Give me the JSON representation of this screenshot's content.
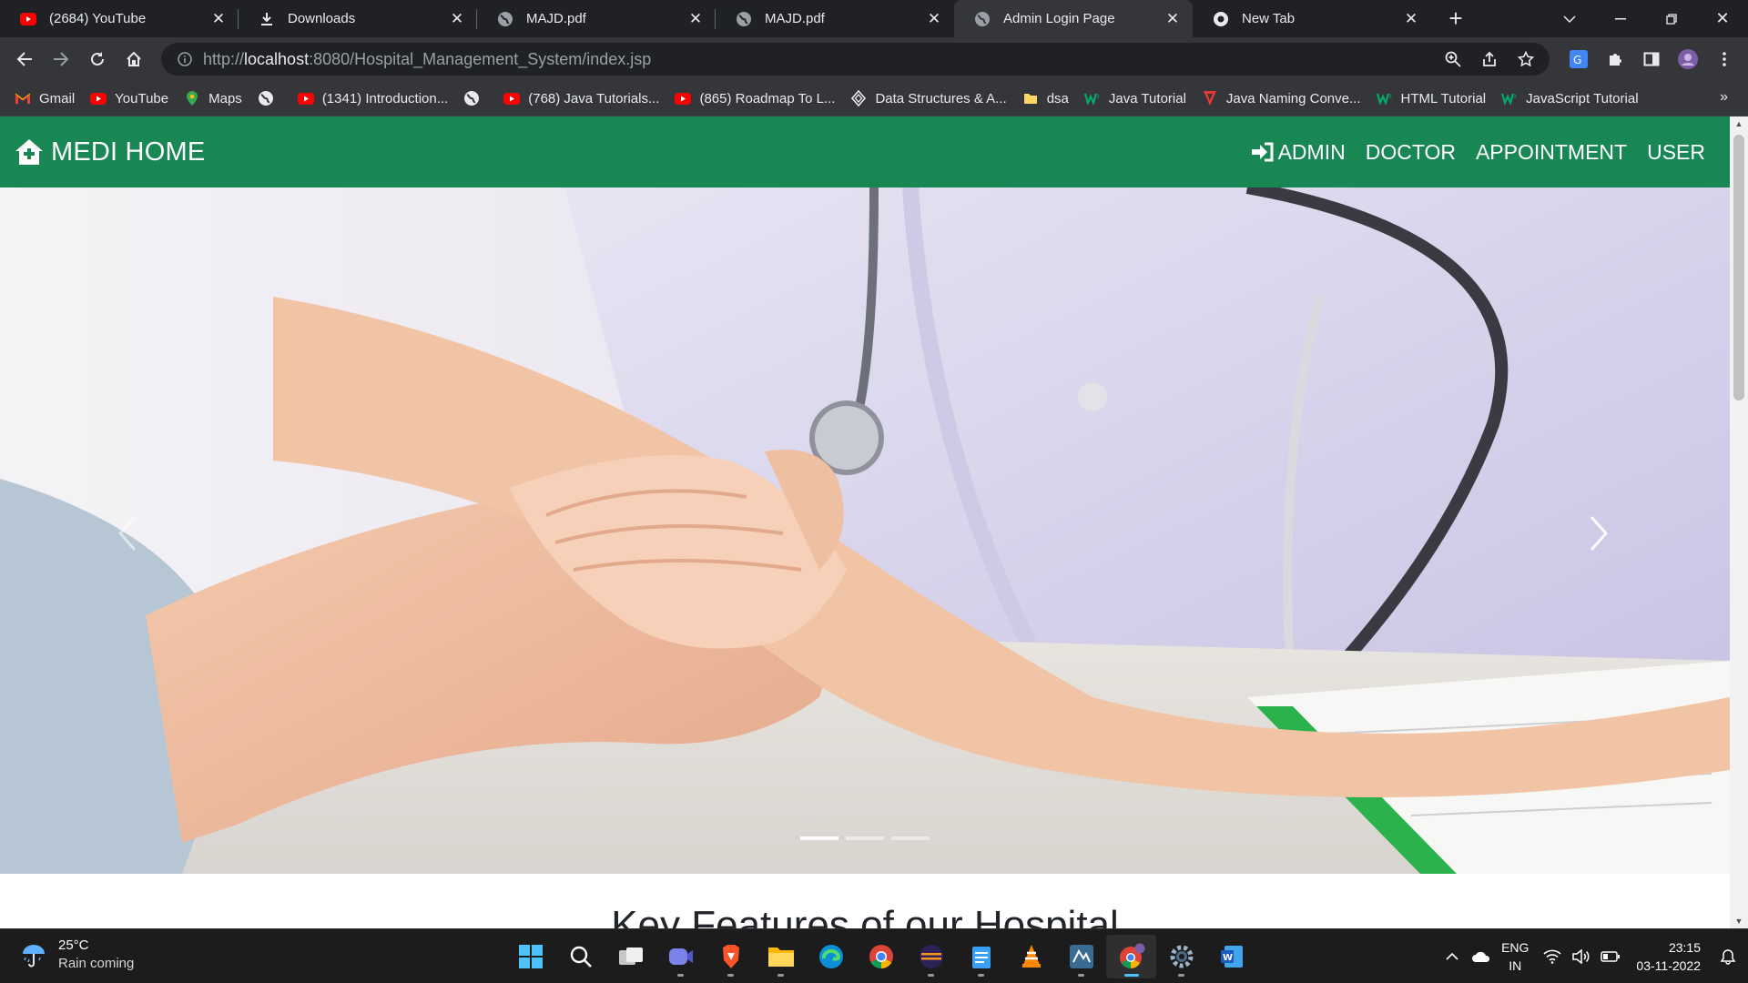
{
  "browser": {
    "tabs": [
      {
        "title": "(2684) YouTube",
        "icon": "youtube-icon",
        "active": false
      },
      {
        "title": "Downloads",
        "icon": "download-icon",
        "active": false
      },
      {
        "title": "MAJD.pdf",
        "icon": "globe-icon",
        "active": false
      },
      {
        "title": "MAJD.pdf",
        "icon": "globe-icon",
        "active": false
      },
      {
        "title": "Admin Login Page",
        "icon": "globe-icon",
        "active": true
      },
      {
        "title": "New Tab",
        "icon": "chrome-icon",
        "active": false
      }
    ],
    "url_prefix": "http://",
    "url_host": "localhost",
    "url_rest": ":8080/Hospital_Management_System/index.jsp",
    "bookmarks": [
      {
        "label": "Gmail",
        "icon": "gmail-icon"
      },
      {
        "label": "YouTube",
        "icon": "youtube-icon"
      },
      {
        "label": "Maps",
        "icon": "maps-icon"
      },
      {
        "label": "",
        "icon": "globe-icon"
      },
      {
        "label": "(1341) Introduction...",
        "icon": "youtube-icon"
      },
      {
        "label": "",
        "icon": "globe-icon"
      },
      {
        "label": "(768) Java Tutorials...",
        "icon": "youtube-icon"
      },
      {
        "label": "(865) Roadmap To L...",
        "icon": "youtube-icon"
      },
      {
        "label": "Data Structures & A...",
        "icon": "dsa-site-icon"
      },
      {
        "label": "dsa",
        "icon": "folder-icon"
      },
      {
        "label": "Java Tutorial",
        "icon": "w3schools-icon"
      },
      {
        "label": "Java Naming Conve...",
        "icon": "javatpoint-icon"
      },
      {
        "label": "HTML Tutorial",
        "icon": "w3schools-icon"
      },
      {
        "label": "JavaScript Tutorial",
        "icon": "w3schools-icon"
      }
    ],
    "more_bookmarks": "»"
  },
  "site": {
    "brand": "MEDI HOME",
    "brand_icon": "hospital-house-icon",
    "nav": [
      {
        "label": "ADMIN",
        "icon": "sign-in-icon"
      },
      {
        "label": "DOCTOR"
      },
      {
        "label": "APPOINTMENT"
      },
      {
        "label": "USER"
      }
    ],
    "hero": {
      "slides": 3,
      "active_slide": 1
    },
    "section_title": "Key Features of our Hospital"
  },
  "taskbar": {
    "weather_temp": "25°C",
    "weather_desc": "Rain coming",
    "apps": [
      "windows-start-icon",
      "search-icon",
      "task-view-icon",
      "teams-icon",
      "brave-icon",
      "file-explorer-icon",
      "edge-icon",
      "chrome-icon",
      "eclipse-icon",
      "notepad-icon",
      "vlc-icon",
      "mysql-workbench-icon",
      "chrome-profile-icon",
      "settings-icon",
      "word-icon"
    ],
    "active_app_index": 12,
    "lang_line1": "ENG",
    "lang_line2": "IN",
    "time": "23:15",
    "date": "03-11-2022"
  },
  "colors": {
    "navbar": "#198754",
    "chrome_dark": "#202124",
    "chrome_toolbar": "#35363a"
  }
}
